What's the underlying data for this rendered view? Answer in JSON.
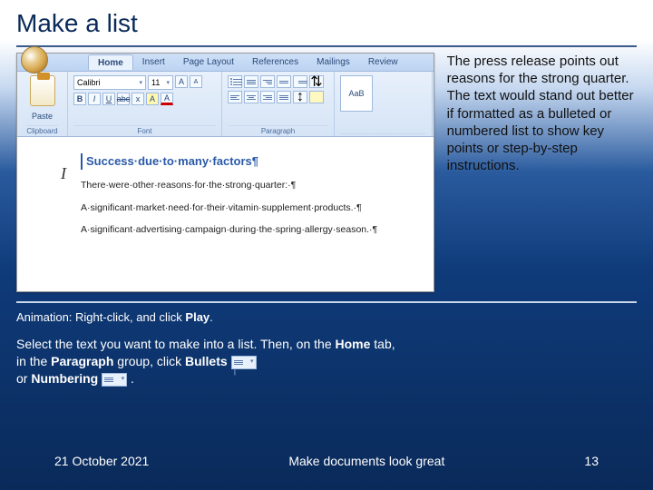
{
  "title": "Make a list",
  "ribbon": {
    "tabs": [
      "Home",
      "Insert",
      "Page Layout",
      "References",
      "Mailings",
      "Review"
    ],
    "active_tab": "Home",
    "font_name": "Calibri",
    "font_size": "11",
    "groups": {
      "clipboard": "Clipboard",
      "font": "Font",
      "paragraph": "Paragraph"
    },
    "style_swatch": "AaB"
  },
  "document": {
    "heading": "Success·due·to·many·factors¶",
    "p1": "There·were·other·reasons·for·the·strong·quarter:·¶",
    "p2": "A·significant·market·need·for·their·vitamin·supplement·products.·¶",
    "p3": "A·significant·advertising·campaign·during·the·spring·allergy·season.·¶"
  },
  "explain": "The press release points out reasons for the strong quarter. The text would stand out better if formatted as a bulleted or numbered list to show key points or step-by-step instructions.",
  "anim_prefix": "Animation: Right-click, and click ",
  "anim_action": "Play",
  "instruct": {
    "l1a": "Select the text you want to make into a list. Then, on the ",
    "l1b": "Home",
    "l1c": " tab, in the ",
    "l1d": "Paragraph",
    "l1e": " group, click ",
    "l1f": "Bullets",
    "l2a": "or ",
    "l2b": "Numbering",
    "l2c": " ."
  },
  "footer": {
    "date": "21 October 2021",
    "center": "Make documents look great",
    "page": "13"
  }
}
